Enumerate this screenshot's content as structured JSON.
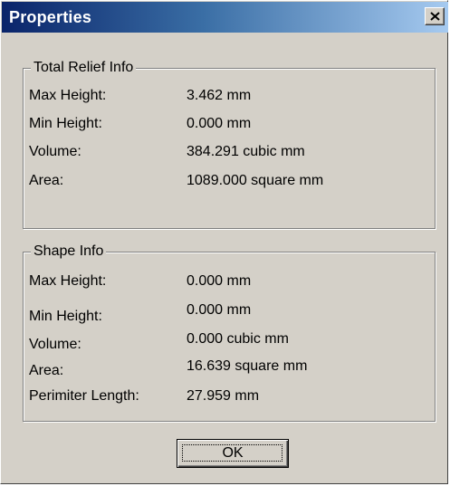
{
  "window": {
    "title": "Properties",
    "close_icon": "close-x-icon"
  },
  "total_relief": {
    "title": "Total Relief Info",
    "rows": [
      {
        "label": "Max Height:",
        "value": "3.462 mm"
      },
      {
        "label": "Min Height:",
        "value": "0.000 mm"
      },
      {
        "label": "Volume:",
        "value": "384.291 cubic mm"
      },
      {
        "label": "Area:",
        "value": "1089.000 square mm"
      }
    ]
  },
  "shape_info": {
    "title": "Shape Info",
    "rows": [
      {
        "label": "Max Height:",
        "value": "0.000 mm"
      },
      {
        "label": "Min Height:",
        "value": "0.000 mm"
      },
      {
        "label": "Volume:",
        "value": "0.000 cubic mm"
      },
      {
        "label": "Area:",
        "value": "16.639 square mm"
      },
      {
        "label": "Perimiter Length:",
        "value": "27.959 mm"
      }
    ]
  },
  "buttons": {
    "ok_label": "OK"
  },
  "colors": {
    "title_gradient_start": "#0a246a",
    "title_gradient_end": "#a6caf0",
    "face": "#d4d0c8"
  }
}
